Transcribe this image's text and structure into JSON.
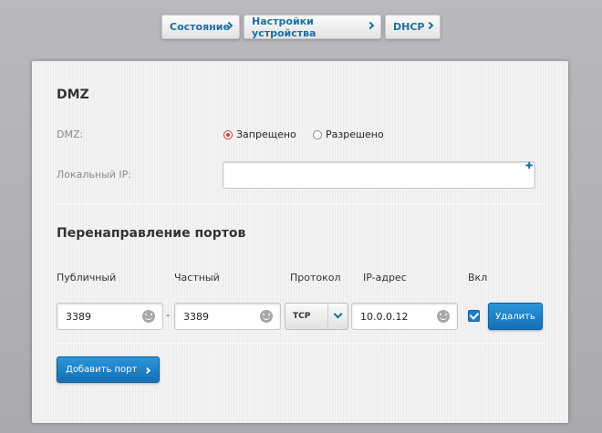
{
  "breadcrumb": [
    {
      "label": "Состояние"
    },
    {
      "label": "Настройки устройства"
    },
    {
      "label": "DHCP"
    }
  ],
  "dmz": {
    "title": "DMZ",
    "field_label": "DMZ:",
    "option_disabled": "Запрещено",
    "option_enabled": "Разрешено",
    "selected": "Запрещено",
    "local_ip_label": "Локальный IP:",
    "local_ip_value": ""
  },
  "port_forwarding": {
    "title": "Перенаправление портов",
    "columns": {
      "public": "Публичный",
      "private": "Частный",
      "protocol": "Протокол",
      "ip": "IP-адрес",
      "enabled": "Вкл"
    },
    "row": {
      "public": "3389",
      "separator": "-",
      "private": "3389",
      "protocol": "TCP",
      "ip": "10.0.0.12",
      "enabled": true,
      "delete_label": "Удалить"
    },
    "add_label": "Добавить порт"
  },
  "colors": {
    "accent": "#1c6fa3",
    "button": "#1f7fc4",
    "radio_selected": "#d23b25"
  }
}
